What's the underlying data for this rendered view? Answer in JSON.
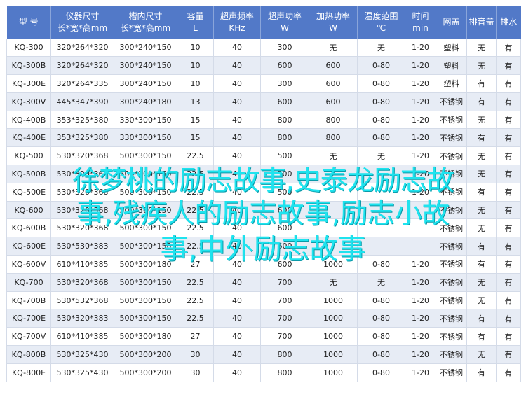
{
  "headers": [
    {
      "l1": "型 号",
      "l2": ""
    },
    {
      "l1": "仪器尺寸",
      "l2": "长*宽*高mm"
    },
    {
      "l1": "槽内尺寸",
      "l2": "长*宽*高mm"
    },
    {
      "l1": "容量",
      "l2": "L"
    },
    {
      "l1": "超声频率",
      "l2": "KHz"
    },
    {
      "l1": "超声功率",
      "l2": "W"
    },
    {
      "l1": "加热功率",
      "l2": "W"
    },
    {
      "l1": "温度范围",
      "l2": "℃"
    },
    {
      "l1": "时间",
      "l2": "min"
    },
    {
      "l1": "网盖",
      "l2": ""
    },
    {
      "l1": "排音盖",
      "l2": ""
    },
    {
      "l1": "排水",
      "l2": ""
    }
  ],
  "rows": [
    [
      "KQ-300",
      "320*264*320",
      "300*240*150",
      "10",
      "40",
      "300",
      "无",
      "无",
      "1-20",
      "塑料",
      "无",
      "有"
    ],
    [
      "KQ-300B",
      "320*264*320",
      "300*240*150",
      "10",
      "40",
      "600",
      "600",
      "0-80",
      "1-20",
      "塑料",
      "无",
      "有"
    ],
    [
      "KQ-300E",
      "320*264*335",
      "300*240*150",
      "10",
      "40",
      "300",
      "600",
      "0-80",
      "1-20",
      "塑料",
      "有",
      "有"
    ],
    [
      "KQ-300V",
      "445*347*390",
      "300*240*180",
      "13",
      "40",
      "600",
      "600",
      "0-80",
      "1-20",
      "不锈钢",
      "有",
      "有"
    ],
    [
      "KQ-400B",
      "353*325*380",
      "330*300*150",
      "15",
      "40",
      "800",
      "800",
      "0-80",
      "1-20",
      "不锈钢",
      "无",
      "有"
    ],
    [
      "KQ-400E",
      "353*325*380",
      "330*300*150",
      "15",
      "40",
      "800",
      "800",
      "0-80",
      "1-20",
      "不锈钢",
      "有",
      "有"
    ],
    [
      "KQ-500",
      "530*320*368",
      "500*300*150",
      "22.5",
      "40",
      "500",
      "无",
      "无",
      "1-20",
      "不锈钢",
      "无",
      "有"
    ],
    [
      "KQ-500B",
      "530*320*368",
      "500*300*150",
      "22.5",
      "40",
      "500",
      "",
      "",
      "1-20",
      "不锈钢",
      "无",
      "有"
    ],
    [
      "KQ-500E",
      "530*320*368",
      "500*300*150",
      "22.5",
      "40",
      "500",
      "",
      "",
      "1-20",
      "不锈钢",
      "有",
      "有"
    ],
    [
      "KQ-600",
      "530*320*368",
      "500*300*150",
      "22.5",
      "40",
      "600",
      "",
      "",
      "",
      "不锈钢",
      "无",
      "有"
    ],
    [
      "KQ-600B",
      "530*320*368",
      "500*300*150",
      "22.5",
      "40",
      "600",
      "",
      "",
      "",
      "不锈钢",
      "无",
      "有"
    ],
    [
      "KQ-600E",
      "530*530*383",
      "500*300*150",
      "22.5",
      "40",
      "600",
      "",
      "",
      "",
      "不锈钢",
      "有",
      "有"
    ],
    [
      "KQ-600V",
      "610*410*385",
      "500*300*180",
      "27",
      "40",
      "600",
      "1000",
      "0-80",
      "1-20",
      "不锈钢",
      "有",
      "有"
    ],
    [
      "KQ-700",
      "530*320*368",
      "500*300*150",
      "22.5",
      "40",
      "700",
      "无",
      "无",
      "1-20",
      "不锈钢",
      "无",
      "有"
    ],
    [
      "KQ-700B",
      "530*532*368",
      "500*300*150",
      "22.5",
      "40",
      "700",
      "1000",
      "0-80",
      "1-20",
      "不锈钢",
      "无",
      "有"
    ],
    [
      "KQ-700E",
      "530*320*383",
      "500*300*150",
      "22.5",
      "40",
      "700",
      "1000",
      "0-80",
      "1-20",
      "不锈钢",
      "有",
      "有"
    ],
    [
      "KQ-700V",
      "610*410*385",
      "500*300*180",
      "27",
      "40",
      "700",
      "1000",
      "0-80",
      "1-20",
      "不锈钢",
      "有",
      "有"
    ],
    [
      "KQ-800B",
      "530*325*430",
      "500*300*200",
      "30",
      "40",
      "800",
      "1000",
      "0-80",
      "1-20",
      "不锈钢",
      "无",
      "有"
    ],
    [
      "KQ-800E",
      "530*325*430",
      "500*300*200",
      "30",
      "40",
      "800",
      "1000",
      "0-80",
      "1-20",
      "不锈钢",
      "有",
      "有"
    ]
  ],
  "overlay": {
    "line1": "徐梦桃的励志故事,史泰龙励志故",
    "line2": "事,残疾人的励志故事,励志小故",
    "line3": "事,中外励志故事"
  },
  "colors": {
    "header_bg": "#5279c8",
    "stripe": "#e7ecf5",
    "overlay": "#1fe3ee"
  }
}
